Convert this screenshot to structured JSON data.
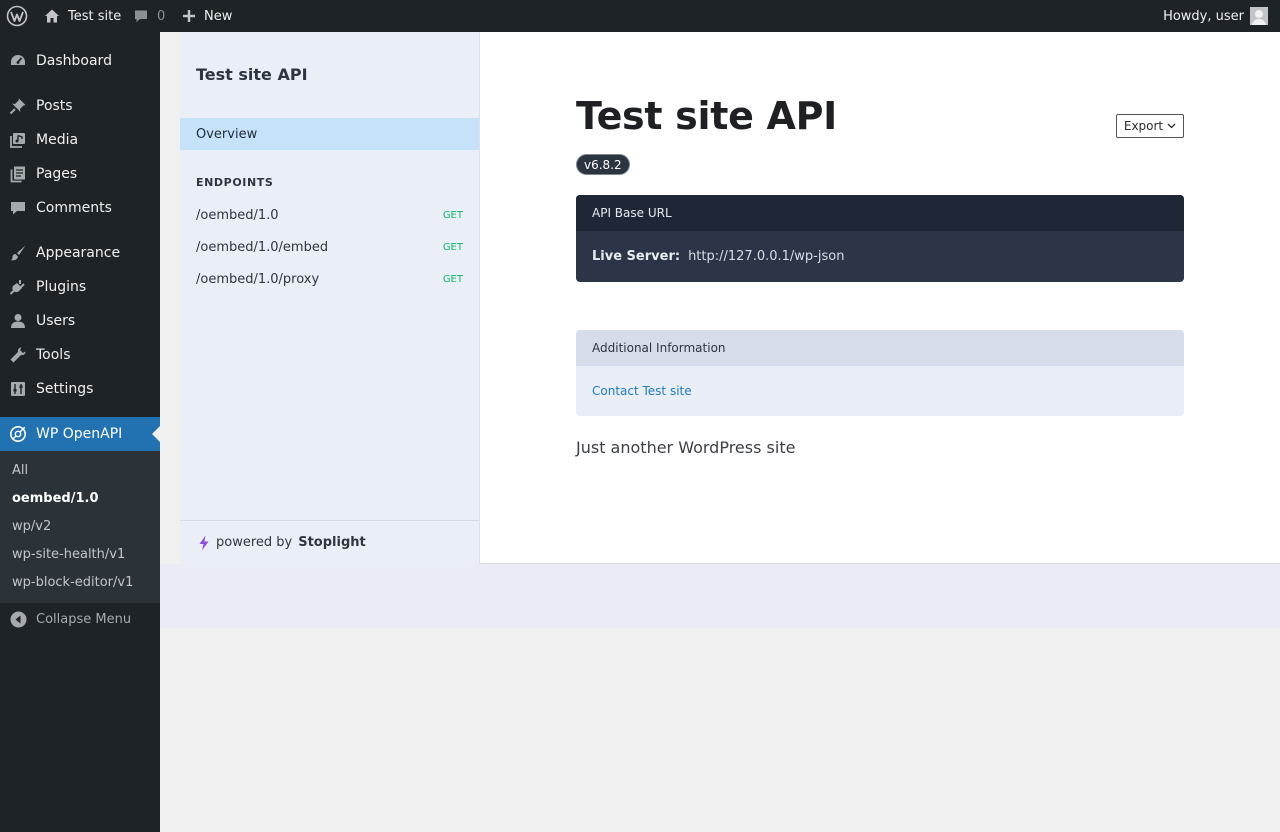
{
  "adminbar": {
    "site_name": "Test site",
    "comments_count": "0",
    "new_label": "New",
    "howdy": "Howdy, user"
  },
  "menu": {
    "items": [
      {
        "label": "Dashboard",
        "icon": "dashboard-icon"
      },
      {
        "label": "Posts",
        "icon": "pin-icon"
      },
      {
        "label": "Media",
        "icon": "media-icon"
      },
      {
        "label": "Pages",
        "icon": "pages-icon"
      },
      {
        "label": "Comments",
        "icon": "comment-icon"
      },
      {
        "label": "Appearance",
        "icon": "brush-icon"
      },
      {
        "label": "Plugins",
        "icon": "plug-icon"
      },
      {
        "label": "Users",
        "icon": "user-icon"
      },
      {
        "label": "Tools",
        "icon": "wrench-icon"
      },
      {
        "label": "Settings",
        "icon": "settings-icon"
      },
      {
        "label": "WP OpenAPI",
        "icon": "openapi-icon"
      }
    ],
    "submenu": [
      "All",
      "oembed/1.0",
      "wp/v2",
      "wp-site-health/v1",
      "wp-block-editor/v1"
    ],
    "collapse_label": "Collapse Menu"
  },
  "stoplight": {
    "title": "Test site API",
    "overview": "Overview",
    "endpoints_heading": "ENDPOINTS",
    "endpoints": [
      {
        "path": "/oembed/1.0",
        "method": "GET"
      },
      {
        "path": "/oembed/1.0/embed",
        "method": "GET"
      },
      {
        "path": "/oembed/1.0/proxy",
        "method": "GET"
      }
    ],
    "powered_prefix": "powered by",
    "powered_brand": "Stoplight"
  },
  "doc": {
    "title": "Test site API",
    "version": "v6.8.2",
    "export_label": "Export",
    "base_url_heading": "API Base URL",
    "live_server_label": "Live Server:",
    "live_server_url": "http://127.0.0.1/wp-json",
    "additional_heading": "Additional Information",
    "contact_link": "Contact Test site",
    "tagline": "Just another WordPress site"
  },
  "colors": {
    "admin_dark": "#1d2327",
    "accent_blue": "#2271b1",
    "method_get": "#10b56a",
    "stoplight_bolt": "#8a4fe0"
  }
}
